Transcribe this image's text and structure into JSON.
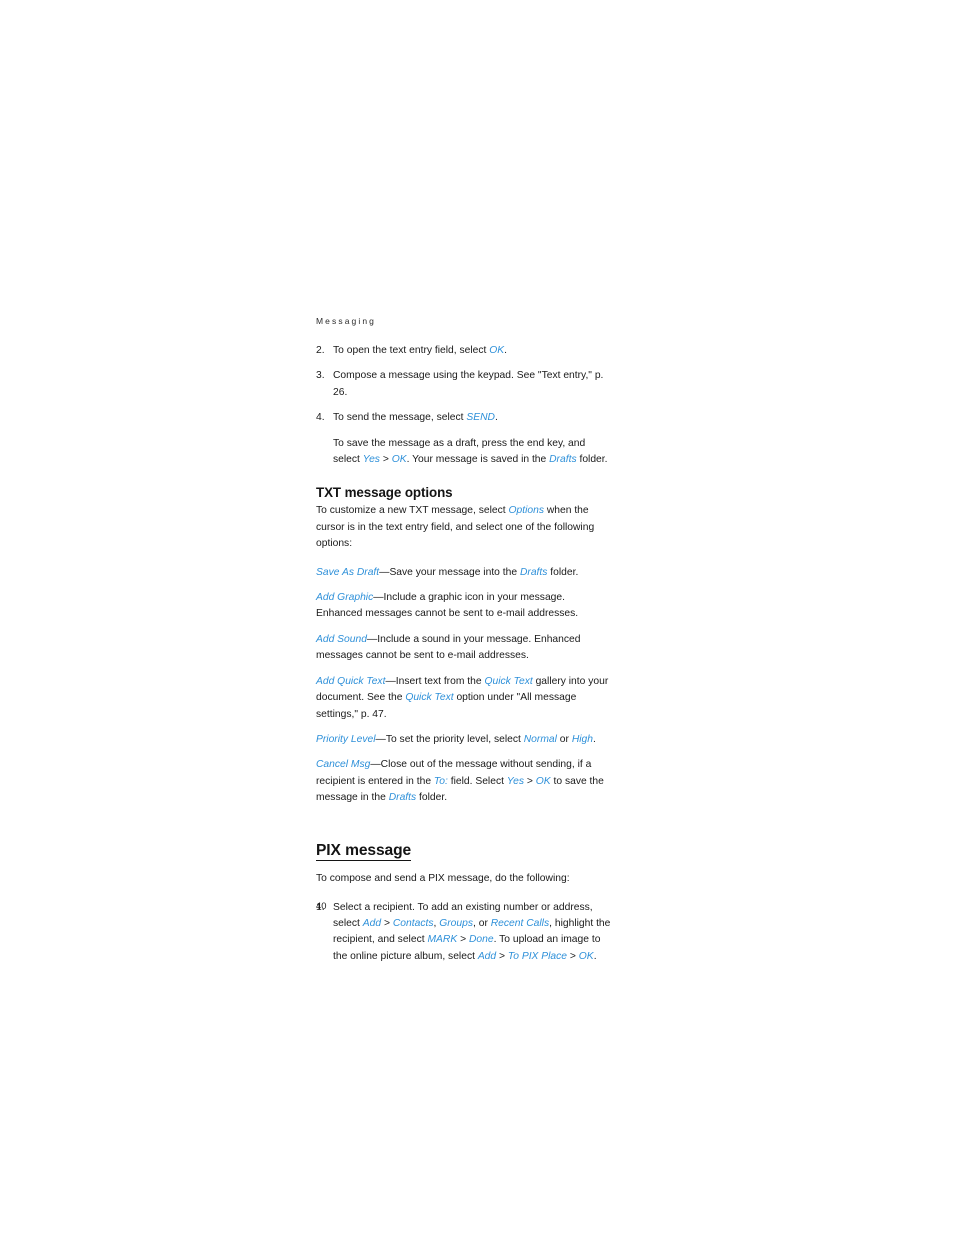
{
  "page": {
    "running_header": "Messaging",
    "folio": "40",
    "accent_color": "#2e90d9",
    "text_color": "#1a1a1a",
    "background": "#ffffff"
  },
  "steps_top": [
    {
      "number": "2.",
      "segments": [
        {
          "text": "To open the text entry field, select ",
          "style": "plain"
        },
        {
          "text": "OK",
          "style": "ui"
        },
        {
          "text": ".",
          "style": "plain"
        }
      ]
    },
    {
      "number": "3.",
      "segments": [
        {
          "text": "Compose a message using the keypad. See \"Text entry,\" p. 26.",
          "style": "plain"
        }
      ]
    },
    {
      "number": "4.",
      "segments": [
        {
          "text": "To send the message, select ",
          "style": "plain"
        },
        {
          "text": "SEND",
          "style": "ui"
        },
        {
          "text": ".",
          "style": "plain"
        }
      ]
    }
  ],
  "substep_draft": [
    {
      "text": "To save the message as a draft, press the end key, and select ",
      "style": "plain"
    },
    {
      "text": "Yes",
      "style": "ui"
    },
    {
      "text": " > ",
      "style": "plain"
    },
    {
      "text": "OK",
      "style": "ui"
    },
    {
      "text": ". Your message is saved in the ",
      "style": "plain"
    },
    {
      "text": "Drafts",
      "style": "ui"
    },
    {
      "text": " folder.",
      "style": "plain"
    }
  ],
  "txt_section": {
    "heading": "TXT message options",
    "intro": [
      {
        "text": "To customize a new TXT message, select ",
        "style": "plain"
      },
      {
        "text": "Options",
        "style": "ui"
      },
      {
        "text": " when the cursor is in the text entry field, and select one of the following options:",
        "style": "plain"
      }
    ],
    "options": [
      [
        {
          "text": "Save As Draft",
          "style": "ui"
        },
        {
          "text": "—Save your message into the ",
          "style": "plain"
        },
        {
          "text": "Drafts",
          "style": "ui"
        },
        {
          "text": " folder.",
          "style": "plain"
        }
      ],
      [
        {
          "text": "Add Graphic",
          "style": "ui"
        },
        {
          "text": "—Include a graphic icon in your message. Enhanced messages cannot be sent to e-mail addresses.",
          "style": "plain"
        }
      ],
      [
        {
          "text": "Add Sound",
          "style": "ui"
        },
        {
          "text": "—Include a sound in your message. Enhanced messages cannot be sent to e-mail addresses.",
          "style": "plain"
        }
      ],
      [
        {
          "text": "Add Quick Text",
          "style": "ui"
        },
        {
          "text": "—Insert text from the ",
          "style": "plain"
        },
        {
          "text": "Quick Text",
          "style": "ui"
        },
        {
          "text": " gallery into your document. See the ",
          "style": "plain"
        },
        {
          "text": "Quick Text",
          "style": "ui"
        },
        {
          "text": " option under \"All message settings,\" p. 47.",
          "style": "plain"
        }
      ],
      [
        {
          "text": "Priority Level",
          "style": "ui"
        },
        {
          "text": "—To set the priority level, select ",
          "style": "plain"
        },
        {
          "text": "Normal",
          "style": "ui"
        },
        {
          "text": " or ",
          "style": "plain"
        },
        {
          "text": "High",
          "style": "ui"
        },
        {
          "text": ".",
          "style": "plain"
        }
      ],
      [
        {
          "text": "Cancel Msg",
          "style": "ui"
        },
        {
          "text": "—Close out of the message without sending, if a recipient is entered in the ",
          "style": "plain"
        },
        {
          "text": "To:",
          "style": "ui"
        },
        {
          "text": " field. Select ",
          "style": "plain"
        },
        {
          "text": "Yes",
          "style": "ui"
        },
        {
          "text": " > ",
          "style": "plain"
        },
        {
          "text": "OK",
          "style": "ui"
        },
        {
          "text": " to save the message in the ",
          "style": "plain"
        },
        {
          "text": "Drafts",
          "style": "ui"
        },
        {
          "text": " folder.",
          "style": "plain"
        }
      ]
    ]
  },
  "pix_section": {
    "heading": "PIX message",
    "intro": [
      {
        "text": "To compose and send a PIX message, do the following:",
        "style": "plain"
      }
    ],
    "steps": [
      {
        "number": "1.",
        "segments": [
          {
            "text": "Select a recipient. To add an existing number or address, select ",
            "style": "plain"
          },
          {
            "text": "Add",
            "style": "ui"
          },
          {
            "text": " > ",
            "style": "plain"
          },
          {
            "text": "Contacts",
            "style": "ui"
          },
          {
            "text": ", ",
            "style": "plain"
          },
          {
            "text": "Groups",
            "style": "ui"
          },
          {
            "text": ", or ",
            "style": "plain"
          },
          {
            "text": "Recent Calls",
            "style": "ui"
          },
          {
            "text": ", highlight the recipient, and select ",
            "style": "plain"
          },
          {
            "text": "MARK",
            "style": "ui"
          },
          {
            "text": " > ",
            "style": "plain"
          },
          {
            "text": "Done",
            "style": "ui"
          },
          {
            "text": ". To upload an image to the online picture album, select ",
            "style": "plain"
          },
          {
            "text": "Add",
            "style": "ui"
          },
          {
            "text": " > ",
            "style": "plain"
          },
          {
            "text": "To PIX Place",
            "style": "ui"
          },
          {
            "text": " > ",
            "style": "plain"
          },
          {
            "text": "OK",
            "style": "ui"
          },
          {
            "text": ".",
            "style": "plain"
          }
        ]
      }
    ]
  }
}
